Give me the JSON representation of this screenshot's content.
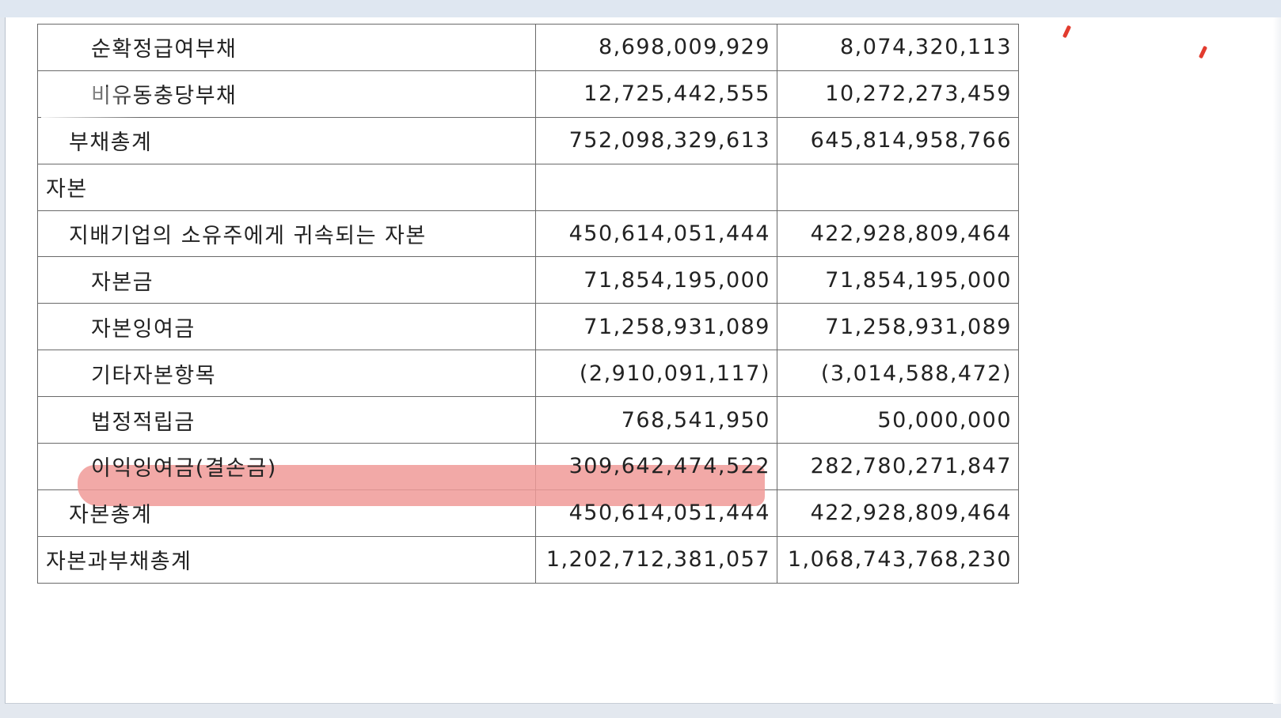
{
  "table": {
    "rows": [
      {
        "label": "순확정급여부채",
        "current": "8,698,009,929",
        "prior": "8,074,320,113"
      },
      {
        "label": "비유동충당부채",
        "current": "12,725,442,555",
        "prior": "10,272,273,459"
      },
      {
        "label": "부채총계",
        "current": "752,098,329,613",
        "prior": "645,814,958,766"
      },
      {
        "label": "자본",
        "current": "",
        "prior": ""
      },
      {
        "label": "지배기업의 소유주에게 귀속되는 자본",
        "current": "450,614,051,444",
        "prior": "422,928,809,464"
      },
      {
        "label": "자본금",
        "current": "71,854,195,000",
        "prior": "71,854,195,000"
      },
      {
        "label": "자본잉여금",
        "current": "71,258,931,089",
        "prior": "71,258,931,089"
      },
      {
        "label": "기타자본항목",
        "current": "(2,910,091,117)",
        "prior": "(3,014,588,472)"
      },
      {
        "label": "법정적립금",
        "current": "768,541,950",
        "prior": "50,000,000"
      },
      {
        "label": "이익잉여금(결손금)",
        "current": "309,642,474,522",
        "prior": "282,780,271,847"
      },
      {
        "label": "자본총계",
        "current": "450,614,051,444",
        "prior": "422,928,809,464"
      },
      {
        "label": "자본과부채총계",
        "current": "1,202,712,381,057",
        "prior": "1,068,743,768,230"
      }
    ]
  },
  "highlight": {
    "row_label": "이익잉여금(결손금)",
    "color": "#f09a98"
  },
  "annotation_color": "#e23b2e",
  "border_color": "#6a6a6a"
}
